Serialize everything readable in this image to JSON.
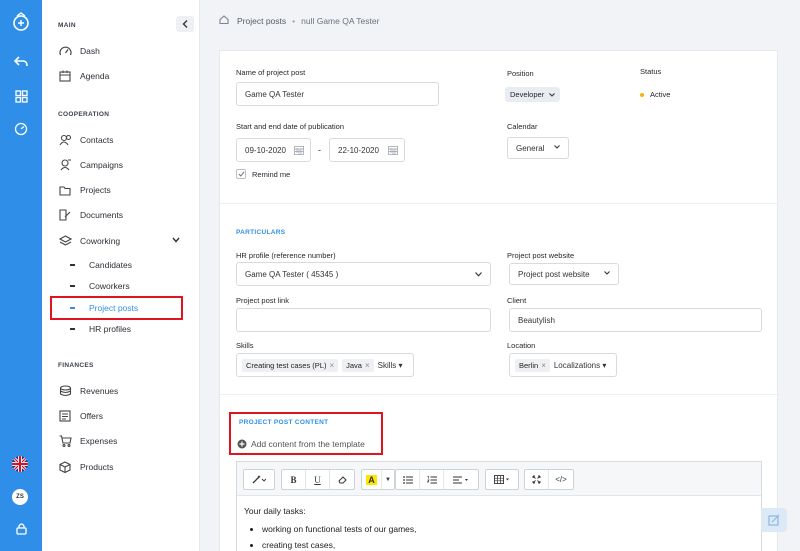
{
  "sidebar": {
    "sections": {
      "main": "MAIN",
      "cooperation": "COOPERATION",
      "finances": "FINANCES"
    },
    "items": {
      "dash": "Dash",
      "agenda": "Agenda",
      "contacts": "Contacts",
      "campaigns": "Campaigns",
      "projects": "Projects",
      "documents": "Documents",
      "coworking": "Coworking",
      "candidates": "Candidates",
      "coworkers": "Coworkers",
      "project_posts": "Project posts",
      "hr_profiles": "HR profiles",
      "revenues": "Revenues",
      "offers": "Offers",
      "expenses": "Expenses",
      "products": "Products"
    }
  },
  "rail": {
    "avatar": "ZS"
  },
  "breadcrumb": {
    "parent": "Project posts",
    "current": "null Game QA Tester"
  },
  "form": {
    "name_label": "Name of project post",
    "name_value": "Game QA Tester",
    "position_label": "Position",
    "position_value": "Developer",
    "status_label": "Status",
    "status_value": "Active",
    "dates_label": "Start and end date of publication",
    "start_date": "09-10-2020",
    "end_date": "22-10-2020",
    "date_sep": "-",
    "calendar_label": "Calendar",
    "calendar_value": "General",
    "remind_label": "Remind me",
    "remind_checked": true
  },
  "particulars": {
    "heading": "PARTICULARS",
    "hr_profile_label": "HR profile (reference number)",
    "hr_profile_value": "Game QA Tester ( 45345 )",
    "website_label": "Project post website",
    "website_value": "Project post website",
    "link_label": "Project post link",
    "link_value": "",
    "client_label": "Client",
    "client_value": "Beautylish",
    "skills_label": "Skills",
    "skills": [
      "Creating test cases (PL)",
      "Java"
    ],
    "skills_more": "Skills",
    "location_label": "Location",
    "locations": [
      "Berlin"
    ],
    "locations_more": "Localizations"
  },
  "content_section": {
    "heading": "PROJECT POST CONTENT",
    "add_template": "Add content from the template",
    "toolbar": {
      "bold": "B",
      "underline": "U",
      "font_color": "A",
      "code": "</>"
    },
    "body_intro": "Your daily tasks:",
    "body_items": [
      "working on functional tests of our games,",
      "creating test cases,"
    ]
  },
  "colors": {
    "accent": "#2f8fe8",
    "highlight": "#e0141e",
    "status": "#f2b705"
  }
}
